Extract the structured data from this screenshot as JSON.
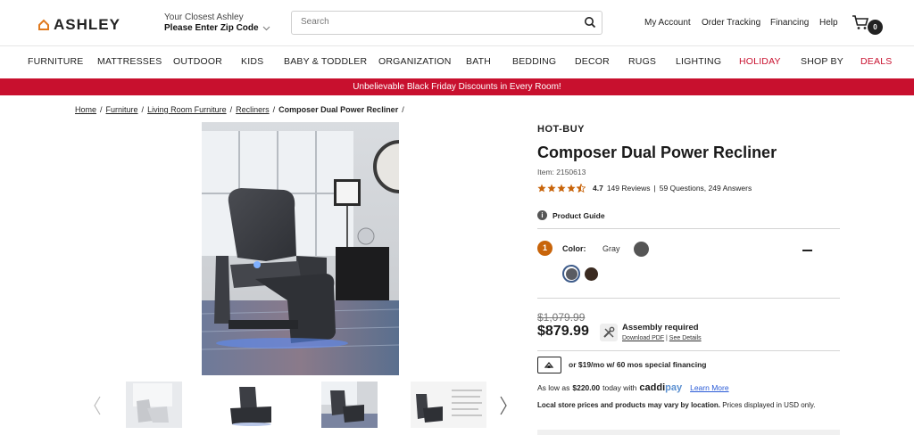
{
  "header": {
    "logo_text": "ASHLEY",
    "store_line1": "Your Closest Ashley",
    "store_line2": "Please Enter Zip Code",
    "search_placeholder": "Search",
    "links": [
      "My Account",
      "Order Tracking",
      "Financing",
      "Help"
    ],
    "cart_count": "0"
  },
  "nav": {
    "items": [
      "FURNITURE",
      "MATTRESSES",
      "OUTDOOR",
      "KIDS",
      "BABY & TODDLER",
      "ORGANIZATION",
      "BATH",
      "BEDDING",
      "DECOR",
      "RUGS",
      "LIGHTING",
      "HOLIDAY",
      "SHOP BY",
      "DEALS"
    ],
    "highlight_color": "#c8102e"
  },
  "banner": {
    "text": "Unbelievable Black Friday Discounts in Every Room!"
  },
  "breadcrumb": {
    "items": [
      "Home",
      "Furniture",
      "Living Room Furniture",
      "Recliners"
    ],
    "current": "Composer Dual Power Recliner"
  },
  "product": {
    "badge": "HOT-BUY",
    "title": "Composer Dual Power Recliner",
    "item_number": "Item: 2150613",
    "rating_value": "4.7",
    "rating_stars": 4.7,
    "reviews": "149 Reviews",
    "qa": "59 Questions, 249 Answers",
    "product_guide": "Product Guide",
    "color_step": "1",
    "color_label": "Color:",
    "color_value": "Gray",
    "was_price": "$1,079.99",
    "price": "$879.99",
    "assembly_title": "Assembly required",
    "assembly_download": "Download PDF",
    "assembly_details": "See Details",
    "financing_text": "or $19/mo w/ 60 mos special financing",
    "caddi_prefix": "As low as",
    "caddi_amount": "$220.00",
    "caddi_suffix": "today with",
    "caddi_brand_a": "caddi",
    "caddi_brand_b": "pay",
    "caddi_learn": "Learn More",
    "store_note_bold": "Local store prices and products may vary by location.",
    "store_note_rest": "Prices displayed in USD only."
  },
  "colors": {
    "accent_red": "#c8102e",
    "step_orange": "#c8640a",
    "star": "#c8640a"
  }
}
